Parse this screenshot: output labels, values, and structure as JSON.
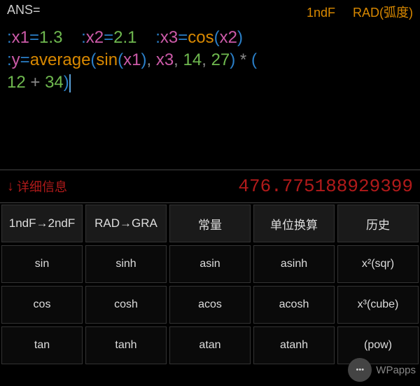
{
  "status": {
    "ans_label": "ANS=",
    "mode1": "1ndF",
    "mode2": "RAD(弧度)"
  },
  "expr": {
    "line1": [
      {
        "t": "colon",
        "v": ":"
      },
      {
        "t": "varname",
        "v": "x1"
      },
      {
        "t": "eq",
        "v": "="
      },
      {
        "t": "num",
        "v": "1.3"
      },
      {
        "t": "space",
        "v": "    "
      },
      {
        "t": "colon",
        "v": ":"
      },
      {
        "t": "varname",
        "v": "x2"
      },
      {
        "t": "eq",
        "v": "="
      },
      {
        "t": "num",
        "v": "2.1"
      },
      {
        "t": "space",
        "v": "    "
      },
      {
        "t": "colon",
        "v": ":"
      },
      {
        "t": "varname",
        "v": "x3"
      },
      {
        "t": "eq",
        "v": "="
      },
      {
        "t": "func",
        "v": "cos"
      },
      {
        "t": "paren",
        "v": "("
      },
      {
        "t": "varname",
        "v": "x2"
      },
      {
        "t": "paren",
        "v": ")"
      }
    ],
    "line2": [
      {
        "t": "colon",
        "v": ":"
      },
      {
        "t": "varname",
        "v": "y"
      },
      {
        "t": "eq",
        "v": "="
      },
      {
        "t": "func",
        "v": "average"
      },
      {
        "t": "paren",
        "v": "("
      },
      {
        "t": "func",
        "v": "sin"
      },
      {
        "t": "paren",
        "v": "("
      },
      {
        "t": "varname",
        "v": "x1"
      },
      {
        "t": "paren",
        "v": ")"
      },
      {
        "t": "op",
        "v": ", "
      },
      {
        "t": "varname",
        "v": "x3"
      },
      {
        "t": "op",
        "v": ", "
      },
      {
        "t": "num",
        "v": "14"
      },
      {
        "t": "op",
        "v": ", "
      },
      {
        "t": "num",
        "v": "27"
      },
      {
        "t": "paren",
        "v": ")"
      },
      {
        "t": "op",
        "v": " * "
      },
      {
        "t": "paren",
        "v": "("
      }
    ],
    "line3": [
      {
        "t": "num",
        "v": "12"
      },
      {
        "t": "op",
        "v": " + "
      },
      {
        "t": "num",
        "v": "34"
      },
      {
        "t": "paren",
        "v": ")"
      },
      {
        "t": "cursor",
        "v": ""
      }
    ]
  },
  "result": {
    "detail_label": "详细信息",
    "value": "476.775188929399"
  },
  "keys": {
    "row0": [
      "1ndF→2ndF",
      "RAD→GRA",
      "常量",
      "单位换算",
      "历史"
    ],
    "row1": [
      "sin",
      "sinh",
      "asin",
      "asinh",
      "x²(sqr)"
    ],
    "row2": [
      "cos",
      "cosh",
      "acos",
      "acosh",
      "x³(cube)"
    ],
    "row3": [
      "tan",
      "tanh",
      "atan",
      "atanh",
      "(pow)"
    ]
  },
  "watermark": {
    "icon": "•••",
    "text": "WPapps"
  }
}
